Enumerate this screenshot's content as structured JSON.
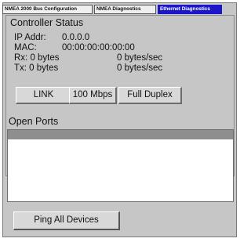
{
  "tabs": [
    {
      "label": "NMEA 2000 Bus Configuration"
    },
    {
      "label": "NMEA Diagnostics"
    },
    {
      "label": "Ethernet Diagnostics"
    }
  ],
  "controller": {
    "section_title": "Controller Status",
    "ip_label": "IP Addr:",
    "ip_value": "0.0.0.0",
    "mac_label": "MAC:",
    "mac_value": "00:00:00:00:00:00",
    "rx_text": "Rx: 0 bytes",
    "rx_rate": "0 bytes/sec",
    "tx_text": "Tx: 0 bytes",
    "tx_rate": "0 bytes/sec",
    "link_label": "LINK",
    "speed_label": "100 Mbps",
    "duplex_label": "Full Duplex"
  },
  "ports": {
    "section_title": "Open Ports"
  },
  "actions": {
    "ping_label": "Ping All Devices"
  }
}
